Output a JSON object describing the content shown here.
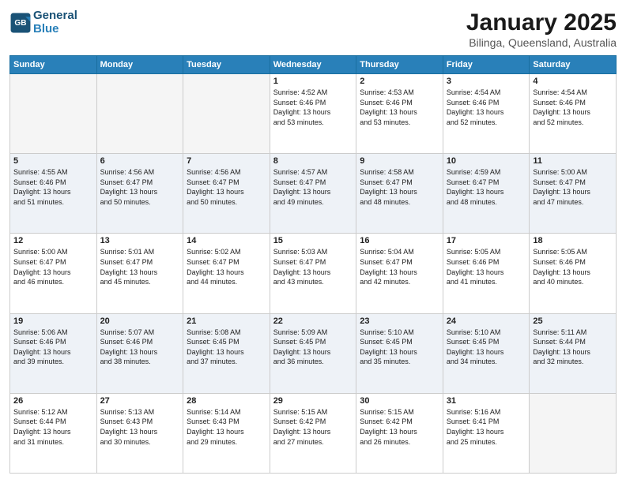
{
  "header": {
    "logo_line1": "General",
    "logo_line2": "Blue",
    "month_title": "January 2025",
    "location": "Bilinga, Queensland, Australia"
  },
  "days_of_week": [
    "Sunday",
    "Monday",
    "Tuesday",
    "Wednesday",
    "Thursday",
    "Friday",
    "Saturday"
  ],
  "weeks": [
    {
      "alt": false,
      "days": [
        {
          "num": "",
          "empty": true,
          "info": ""
        },
        {
          "num": "",
          "empty": true,
          "info": ""
        },
        {
          "num": "",
          "empty": true,
          "info": ""
        },
        {
          "num": "1",
          "empty": false,
          "info": "Sunrise: 4:52 AM\nSunset: 6:46 PM\nDaylight: 13 hours\nand 53 minutes."
        },
        {
          "num": "2",
          "empty": false,
          "info": "Sunrise: 4:53 AM\nSunset: 6:46 PM\nDaylight: 13 hours\nand 53 minutes."
        },
        {
          "num": "3",
          "empty": false,
          "info": "Sunrise: 4:54 AM\nSunset: 6:46 PM\nDaylight: 13 hours\nand 52 minutes."
        },
        {
          "num": "4",
          "empty": false,
          "info": "Sunrise: 4:54 AM\nSunset: 6:46 PM\nDaylight: 13 hours\nand 52 minutes."
        }
      ]
    },
    {
      "alt": true,
      "days": [
        {
          "num": "5",
          "empty": false,
          "info": "Sunrise: 4:55 AM\nSunset: 6:46 PM\nDaylight: 13 hours\nand 51 minutes."
        },
        {
          "num": "6",
          "empty": false,
          "info": "Sunrise: 4:56 AM\nSunset: 6:47 PM\nDaylight: 13 hours\nand 50 minutes."
        },
        {
          "num": "7",
          "empty": false,
          "info": "Sunrise: 4:56 AM\nSunset: 6:47 PM\nDaylight: 13 hours\nand 50 minutes."
        },
        {
          "num": "8",
          "empty": false,
          "info": "Sunrise: 4:57 AM\nSunset: 6:47 PM\nDaylight: 13 hours\nand 49 minutes."
        },
        {
          "num": "9",
          "empty": false,
          "info": "Sunrise: 4:58 AM\nSunset: 6:47 PM\nDaylight: 13 hours\nand 48 minutes."
        },
        {
          "num": "10",
          "empty": false,
          "info": "Sunrise: 4:59 AM\nSunset: 6:47 PM\nDaylight: 13 hours\nand 48 minutes."
        },
        {
          "num": "11",
          "empty": false,
          "info": "Sunrise: 5:00 AM\nSunset: 6:47 PM\nDaylight: 13 hours\nand 47 minutes."
        }
      ]
    },
    {
      "alt": false,
      "days": [
        {
          "num": "12",
          "empty": false,
          "info": "Sunrise: 5:00 AM\nSunset: 6:47 PM\nDaylight: 13 hours\nand 46 minutes."
        },
        {
          "num": "13",
          "empty": false,
          "info": "Sunrise: 5:01 AM\nSunset: 6:47 PM\nDaylight: 13 hours\nand 45 minutes."
        },
        {
          "num": "14",
          "empty": false,
          "info": "Sunrise: 5:02 AM\nSunset: 6:47 PM\nDaylight: 13 hours\nand 44 minutes."
        },
        {
          "num": "15",
          "empty": false,
          "info": "Sunrise: 5:03 AM\nSunset: 6:47 PM\nDaylight: 13 hours\nand 43 minutes."
        },
        {
          "num": "16",
          "empty": false,
          "info": "Sunrise: 5:04 AM\nSunset: 6:47 PM\nDaylight: 13 hours\nand 42 minutes."
        },
        {
          "num": "17",
          "empty": false,
          "info": "Sunrise: 5:05 AM\nSunset: 6:46 PM\nDaylight: 13 hours\nand 41 minutes."
        },
        {
          "num": "18",
          "empty": false,
          "info": "Sunrise: 5:05 AM\nSunset: 6:46 PM\nDaylight: 13 hours\nand 40 minutes."
        }
      ]
    },
    {
      "alt": true,
      "days": [
        {
          "num": "19",
          "empty": false,
          "info": "Sunrise: 5:06 AM\nSunset: 6:46 PM\nDaylight: 13 hours\nand 39 minutes."
        },
        {
          "num": "20",
          "empty": false,
          "info": "Sunrise: 5:07 AM\nSunset: 6:46 PM\nDaylight: 13 hours\nand 38 minutes."
        },
        {
          "num": "21",
          "empty": false,
          "info": "Sunrise: 5:08 AM\nSunset: 6:45 PM\nDaylight: 13 hours\nand 37 minutes."
        },
        {
          "num": "22",
          "empty": false,
          "info": "Sunrise: 5:09 AM\nSunset: 6:45 PM\nDaylight: 13 hours\nand 36 minutes."
        },
        {
          "num": "23",
          "empty": false,
          "info": "Sunrise: 5:10 AM\nSunset: 6:45 PM\nDaylight: 13 hours\nand 35 minutes."
        },
        {
          "num": "24",
          "empty": false,
          "info": "Sunrise: 5:10 AM\nSunset: 6:45 PM\nDaylight: 13 hours\nand 34 minutes."
        },
        {
          "num": "25",
          "empty": false,
          "info": "Sunrise: 5:11 AM\nSunset: 6:44 PM\nDaylight: 13 hours\nand 32 minutes."
        }
      ]
    },
    {
      "alt": false,
      "days": [
        {
          "num": "26",
          "empty": false,
          "info": "Sunrise: 5:12 AM\nSunset: 6:44 PM\nDaylight: 13 hours\nand 31 minutes."
        },
        {
          "num": "27",
          "empty": false,
          "info": "Sunrise: 5:13 AM\nSunset: 6:43 PM\nDaylight: 13 hours\nand 30 minutes."
        },
        {
          "num": "28",
          "empty": false,
          "info": "Sunrise: 5:14 AM\nSunset: 6:43 PM\nDaylight: 13 hours\nand 29 minutes."
        },
        {
          "num": "29",
          "empty": false,
          "info": "Sunrise: 5:15 AM\nSunset: 6:42 PM\nDaylight: 13 hours\nand 27 minutes."
        },
        {
          "num": "30",
          "empty": false,
          "info": "Sunrise: 5:15 AM\nSunset: 6:42 PM\nDaylight: 13 hours\nand 26 minutes."
        },
        {
          "num": "31",
          "empty": false,
          "info": "Sunrise: 5:16 AM\nSunset: 6:41 PM\nDaylight: 13 hours\nand 25 minutes."
        },
        {
          "num": "",
          "empty": true,
          "info": ""
        }
      ]
    }
  ]
}
